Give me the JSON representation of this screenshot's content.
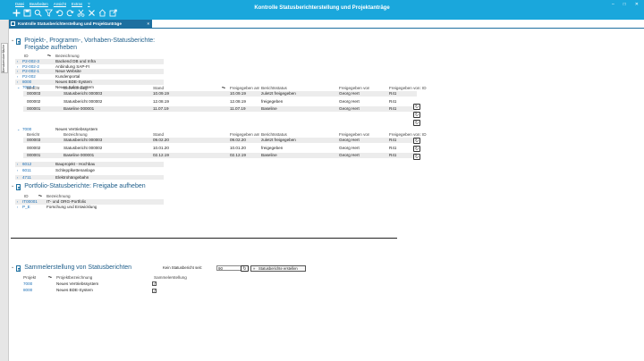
{
  "window": {
    "title": "Kontrolle Statusberichterstellung und Projektanträge",
    "menu": [
      "Datei",
      "Bearbeiten",
      "Ansicht",
      "Extras",
      "?"
    ],
    "controls": [
      "–",
      "□",
      "✕"
    ]
  },
  "side_tab": "Benutzeroberfläche",
  "doc_tab": "Kontrolle Statusberichterstellung und Projektanträge",
  "icons": {
    "toolbar": [
      "plus-icon",
      "save-icon",
      "search-icon",
      "filter-icon",
      "undo-icon",
      "redo-icon",
      "cut-icon",
      "delete-icon",
      "home-icon",
      "export-icon"
    ]
  },
  "sec1": {
    "title_line1": "Projekt-, Programm-, Vorhaben-Statusberichte:",
    "title_line2": "Freigabe aufheben",
    "headers": {
      "id": "ID",
      "name": "Bezeichnung"
    },
    "items": [
      {
        "id": "P2-002-3",
        "name": "Backend DB und Infra"
      },
      {
        "id": "P2-002-2",
        "name": "Anbindung SAP-FI"
      },
      {
        "id": "P2-002-1",
        "name": "Neue Website"
      },
      {
        "id": "P2-002",
        "name": "Kundenportal"
      },
      {
        "id": "8000",
        "name": "Neues BDE-System"
      },
      {
        "id": "7000-F",
        "name": "Neues Sales-System"
      }
    ],
    "sub_headers": {
      "report": "Bericht",
      "name": "Bezeichnung",
      "stand": "Stand",
      "released_on": "Freigegeben am",
      "status": "Berichtsstatus",
      "released_by": "Freigegeben von",
      "released_by2": "Freigegeben von: ID"
    },
    "group1": [
      {
        "report": "000003",
        "name": "Statusbericht 000003",
        "stand": "10.09.19",
        "released_on": "10.09.19",
        "status": "zuletzt freigegeben",
        "released_by": "Georg Hert",
        "id": "R41"
      },
      {
        "report": "000002",
        "name": "Statusbericht 000002",
        "stand": "12.08.19",
        "released_on": "12.08.19",
        "status": "freigegeben",
        "released_by": "Georg Hert",
        "id": "R41"
      },
      {
        "report": "000001",
        "name": "Baseline 000001",
        "stand": "11.07.19",
        "released_on": "11.07.19",
        "status": "Baseline",
        "released_by": "Georg Hert",
        "id": "R41"
      }
    ],
    "item_7000": {
      "id": "7000",
      "name": "Neues Vertriebssystem"
    },
    "group2": [
      {
        "report": "000003",
        "name": "Statusbericht 000003",
        "stand": "09.02.20",
        "released_on": "09.02.20",
        "status": "zuletzt freigegeben",
        "released_by": "Georg Hert",
        "id": "R41"
      },
      {
        "report": "000002",
        "name": "Statusbericht 000002",
        "stand": "10.01.20",
        "released_on": "10.01.20",
        "status": "freigegeben",
        "released_by": "Georg Hert",
        "id": "R41"
      },
      {
        "report": "000001",
        "name": "Baseline 000001",
        "stand": "02.12.19",
        "released_on": "02.12.19",
        "status": "Baseline",
        "released_by": "Georg Hert",
        "id": "R41"
      }
    ],
    "items_after": [
      {
        "id": "6012",
        "name": "Bauprojekt - Hochbau"
      },
      {
        "id": "6011",
        "name": "Schlepplkettenanlage"
      },
      {
        "id": "4711",
        "name": "Elektrohängebahn"
      }
    ]
  },
  "sec2": {
    "title": "Portfolio-Statusberichte: Freigabe aufheben",
    "headers": {
      "id": "ID",
      "name": "Bezeichnung"
    },
    "items": [
      {
        "id": "IT00001",
        "name": "IT- und ORG-Portfolio"
      },
      {
        "id": "P_E",
        "name": "Forschung und Entwicklung"
      }
    ]
  },
  "sec3": {
    "title": "Sammelerstellung von Statusberichten",
    "last_label": "Kein Statusbericht seit:",
    "days_value": "90",
    "create_button": "Statusberichte erstellen",
    "headers": {
      "project": "Projekt",
      "name": "Projektbezeichnung",
      "collect": "Sammelerstellung"
    },
    "items": [
      {
        "project": "7000",
        "name": "Neues Vertriebssystem"
      },
      {
        "project": "8000",
        "name": "Neues BDE-System"
      }
    ]
  }
}
